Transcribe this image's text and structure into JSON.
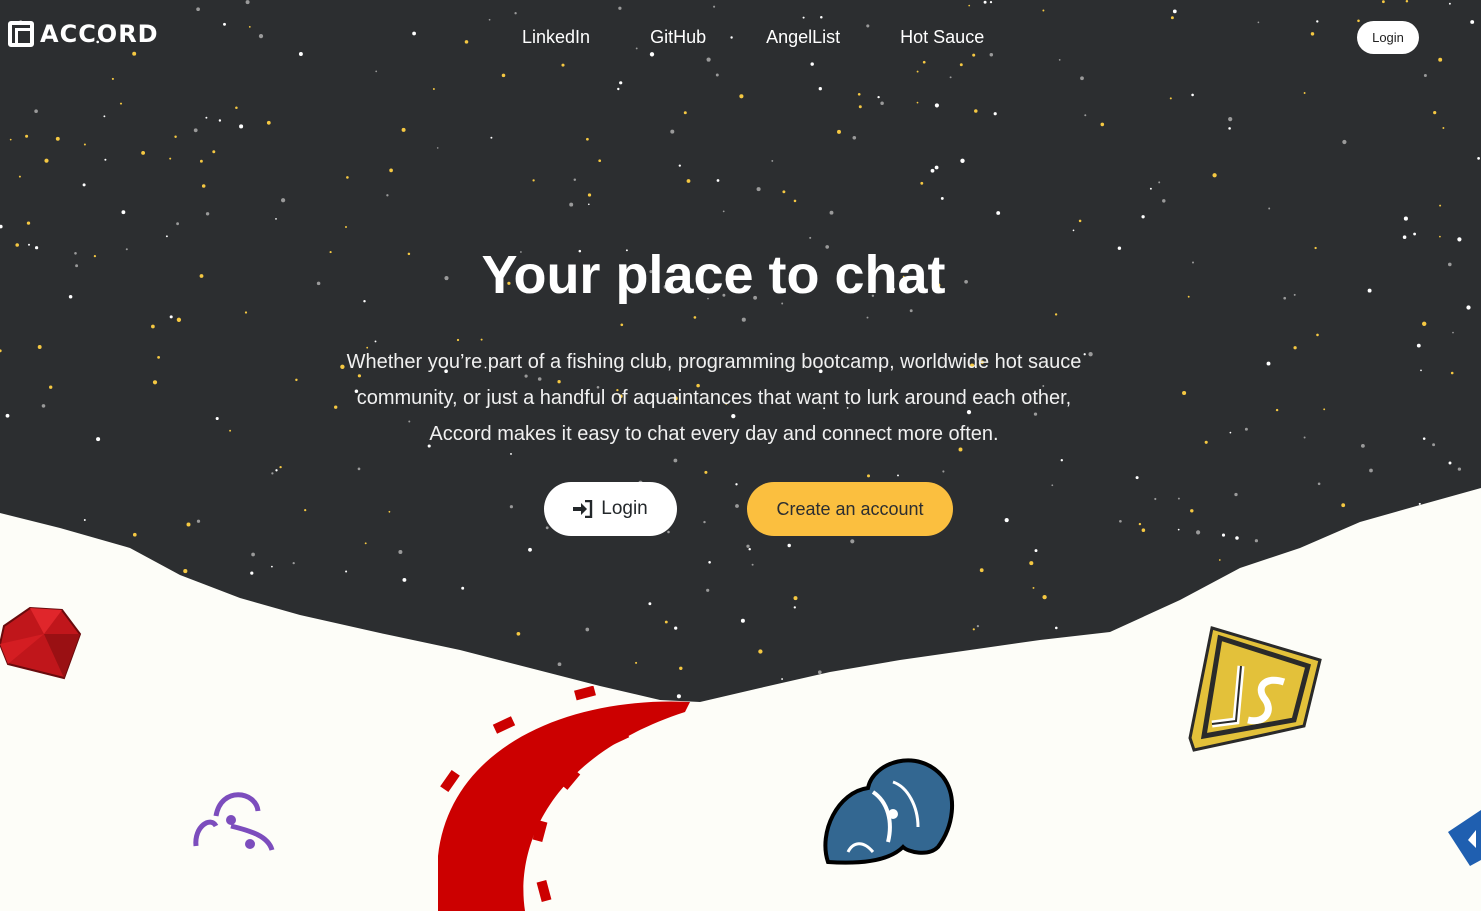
{
  "brand": {
    "name": "ACCORD",
    "icon": "accord-logo-icon"
  },
  "nav": {
    "links": [
      "LinkedIn",
      "GitHub",
      "AngelList",
      "Hot Sauce"
    ],
    "login_label": "Login"
  },
  "hero": {
    "title": "Your place to chat",
    "description": "Whether you’re part of a fishing club, programming bootcamp, worldwide hot sauce community, or just a handful of aquaintances that want to lurk around each other, Accord makes it easy to chat every day and connect more often.",
    "login_label": "Login",
    "login_icon": "sign-in-icon",
    "create_label": "Create an account"
  },
  "decorations": [
    "ruby-gem-icon",
    "redux-saga-icon",
    "rails-logo-icon",
    "postgresql-elephant-icon",
    "javascript-shield-icon",
    "jquery-icon"
  ],
  "colors": {
    "background_dark": "#2c2e30",
    "background_light": "#fdfdf8",
    "accent": "#fbbf3f",
    "star_yellow": "#f5c842"
  }
}
